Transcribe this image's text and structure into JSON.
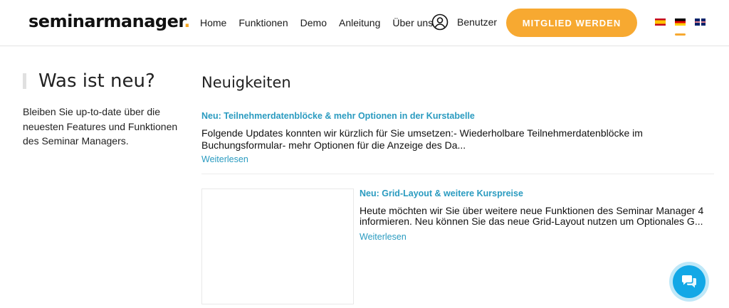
{
  "header": {
    "logo_text": "seminarmanager",
    "logo_dot": ".",
    "nav": [
      "Home",
      "Funktionen",
      "Demo",
      "Anleitung",
      "Über uns"
    ],
    "user_label": "Benutzer",
    "cta_label": "MITGLIED WERDEN"
  },
  "sidebar": {
    "title": "Was ist neu?",
    "description": "Bleiben Sie up-to-date über die neuesten Features und Funktionen des Seminar Managers."
  },
  "main": {
    "title": "Neuigkeiten",
    "news": [
      {
        "title": "Neu: Teilnehmerdatenblöcke & mehr Optionen in der Kurstabelle",
        "text": "Folgende Updates konnten wir kürzlich für Sie umsetzen:- Wiederholbare Teilnehmerdatenblöcke im Buchungsformular- mehr Optionen für die Anzeige des Da...",
        "more": "Weiterlesen"
      },
      {
        "title": "Neu: Grid-Layout & weitere Kurspreise",
        "text": "Heute möchten wir Sie über weitere neue Funktionen des Seminar Manager 4 informieren. Neu können Sie das neue Grid-Layout nutzen um  Optionales G...",
        "more": "Weiterlesen"
      }
    ]
  },
  "colors": {
    "accent": "#f7a931",
    "link": "#2a9bc0",
    "chat": "#13a8e6"
  },
  "icons": {
    "user": "user-circle-icon",
    "chat": "chat-bubbles-icon"
  }
}
